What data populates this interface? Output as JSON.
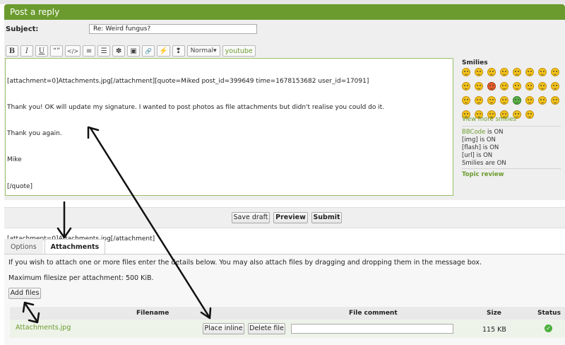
{
  "header": {
    "title": "Post a reply"
  },
  "subject": {
    "label": "Subject:",
    "value": "Re: Weird fungus?"
  },
  "toolbar": {
    "buttons": [
      "B",
      "I",
      "U",
      "“”",
      "</>",
      "≡",
      "☰",
      "✽",
      "▣",
      "🔗",
      "⚡",
      "❢"
    ],
    "size_label": "Normal",
    "youtube_label": "youtube"
  },
  "editor": {
    "lines": [
      "[attachment=0]Attachments.jpg[/attachment][quote=Miked post_id=399649 time=1678153682 user_id=17091]",
      "Thank you! OK will update my signature. I wanted to post photos as file attachments but didn't realise you could do it.",
      "Thank you again.",
      "Mike",
      "[/quote]",
      "",
      "[attachment=0]Attachments.jpg[/attachment]"
    ]
  },
  "smilies": {
    "title": "Smilies",
    "view_more": "View more smilies"
  },
  "bbinfo": {
    "bbcode_link": "BBCode",
    "bbcode_state": " is ON",
    "img": "[img] is ON",
    "flash": "[flash] is ON",
    "url": "[url] is ON",
    "smilies": "Smilies are ON"
  },
  "topic_review": "Topic review",
  "actions": {
    "save_draft": "Save draft",
    "preview": "Preview",
    "submit": "Submit"
  },
  "tabs": {
    "options": "Options",
    "attachments": "Attachments"
  },
  "attachments": {
    "help": "If you wish to attach one or more files enter the details below. You may also attach files by dragging and dropping them in the message box.",
    "max_size": "Maximum filesize per attachment: 500 KiB.",
    "add_files": "Add files",
    "columns": {
      "filename": "Filename",
      "comment": "File comment",
      "size": "Size",
      "status": "Status"
    },
    "rows": [
      {
        "filename": "Attachments.jpg",
        "place_inline": "Place inline",
        "delete": "Delete file",
        "comment": "",
        "size": "115 KB",
        "status_icon": "check-circle-icon"
      }
    ]
  },
  "colors": {
    "accent": "#6b9b2e",
    "panel": "#efefef"
  }
}
